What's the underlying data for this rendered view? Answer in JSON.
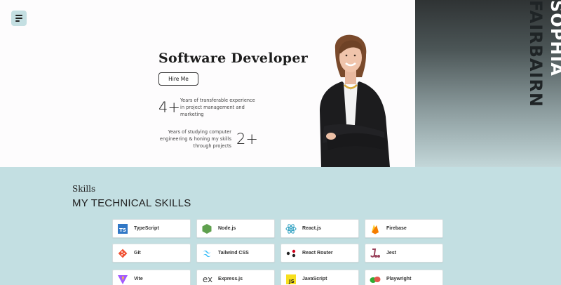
{
  "hero": {
    "title": "Software Developer",
    "hire_label": "Hire Me",
    "stat1": {
      "value": "4+",
      "text": "Years of transferable experience in project management and marketing"
    },
    "stat2": {
      "value": "2+",
      "text": "Years of studying computer engineering & honing my skills through projects"
    },
    "name_first": "SOPHIA",
    "name_last": "FAIRBAIRN"
  },
  "skills": {
    "label": "Skills",
    "heading": "MY TECHNICAL SKILLS",
    "items": [
      {
        "label": "TypeScript",
        "icon": "typescript-icon"
      },
      {
        "label": "Node.js",
        "icon": "nodejs-icon"
      },
      {
        "label": "React.js",
        "icon": "react-icon"
      },
      {
        "label": "Firebase",
        "icon": "firebase-icon"
      },
      {
        "label": "Git",
        "icon": "git-icon"
      },
      {
        "label": "Tailwind CSS",
        "icon": "tailwind-icon"
      },
      {
        "label": "React Router",
        "icon": "react-router-icon"
      },
      {
        "label": "Jest",
        "icon": "jest-icon"
      },
      {
        "label": "Vite",
        "icon": "vite-icon"
      },
      {
        "label": "Express.js",
        "icon": "express-icon"
      },
      {
        "label": "JavaScript",
        "icon": "javascript-icon"
      },
      {
        "label": "Playwright",
        "icon": "playwright-icon"
      }
    ]
  },
  "colors": {
    "skills_bg": "#c3dfe2",
    "menu_bg": "#c4dfe2",
    "panel_dark": "#2f3334"
  }
}
